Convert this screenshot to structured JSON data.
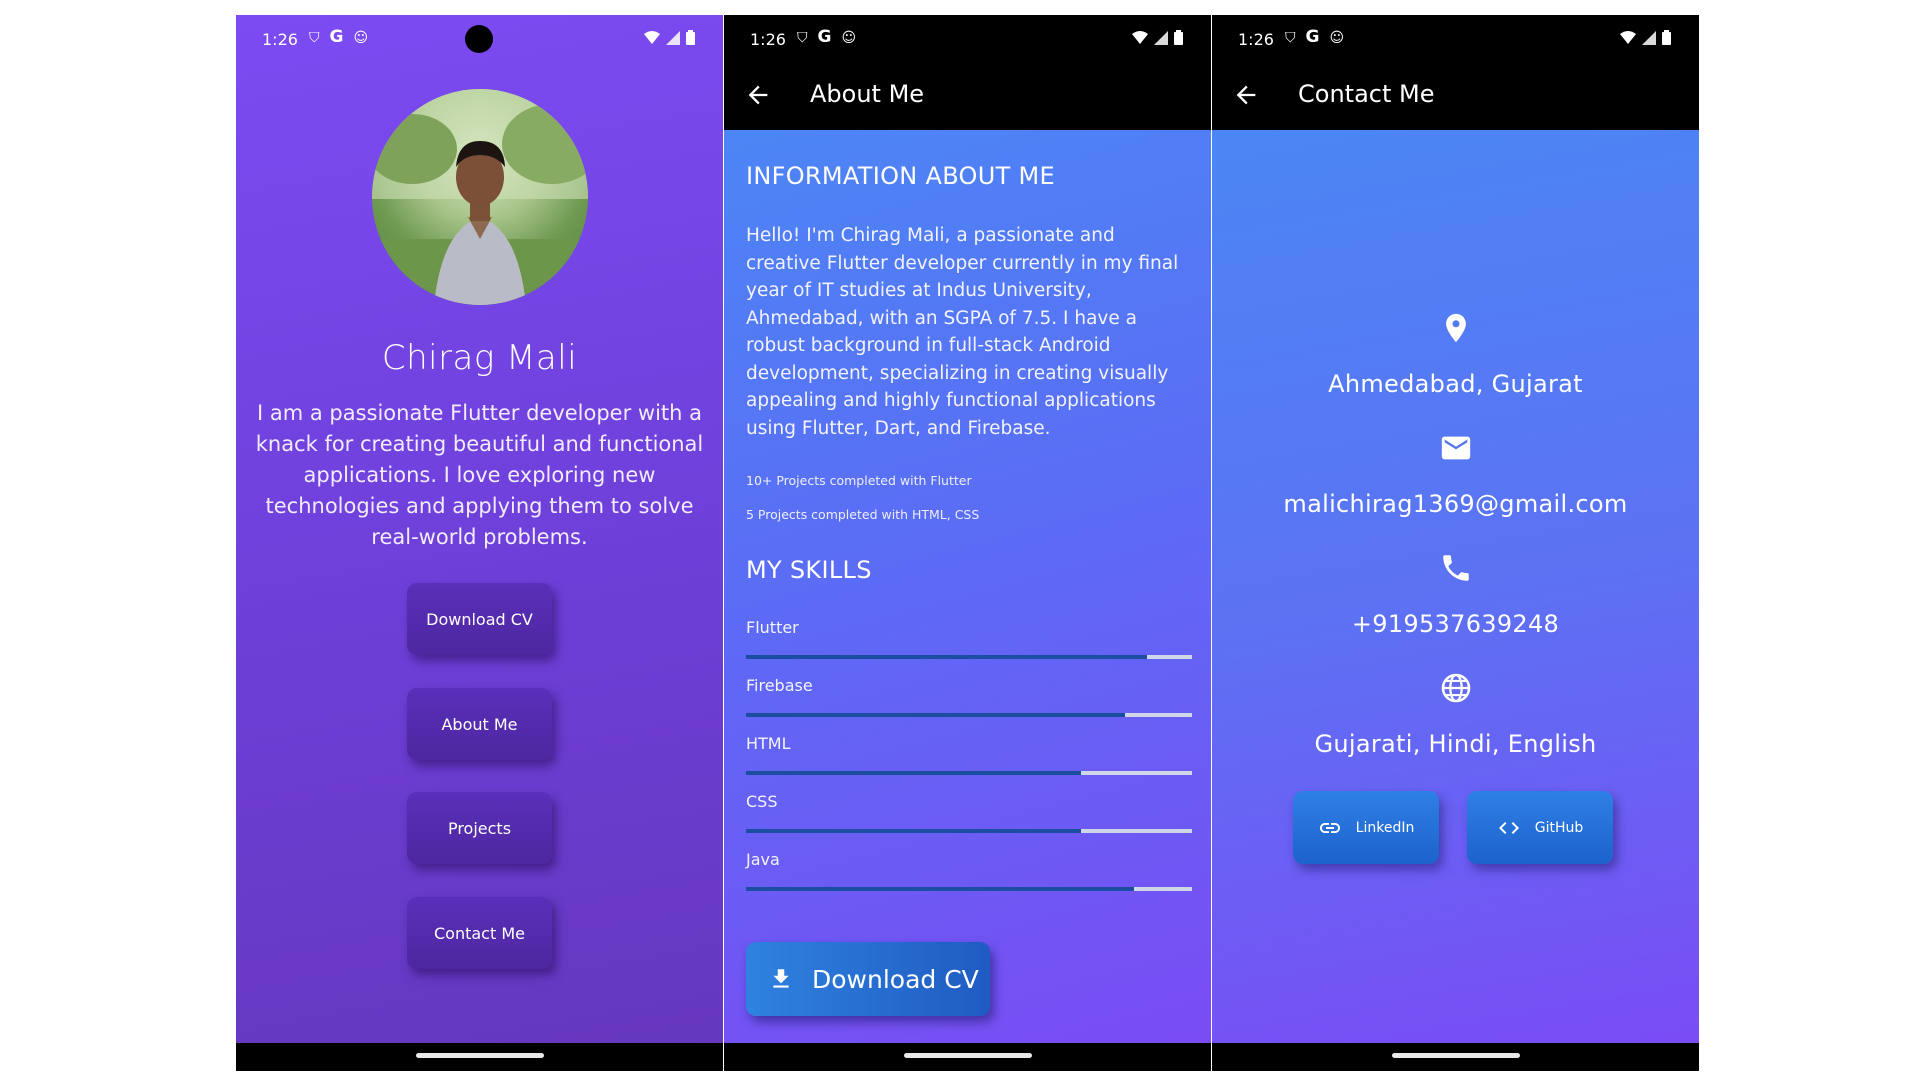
{
  "status_bar": {
    "time": "1:26"
  },
  "home": {
    "name": "Chirag Mali",
    "bio": "I am a passionate Flutter developer with a knack for creating beautiful and functional applications. I love exploring new technologies and applying them to solve real-world problems.",
    "buttons": [
      "Download CV",
      "About Me",
      "Projects",
      "Contact Me"
    ]
  },
  "about": {
    "app_title": "About Me",
    "info_heading": "INFORMATION ABOUT ME",
    "info_text": "Hello! I'm Chirag Mali, a passionate and creative Flutter developer currently in my final year of IT studies at Indus University, Ahmedabad, with an SGPA of 7.5. I have a robust background in full-stack Android development, specializing in creating visually appealing and highly functional applications using Flutter, Dart, and Firebase.",
    "notes": [
      "10+ Projects completed with Flutter",
      "5 Projects completed with HTML, CSS"
    ],
    "skills_heading": "MY SKILLS",
    "skills": [
      {
        "name": "Flutter",
        "level": 0.9
      },
      {
        "name": "Firebase",
        "level": 0.85
      },
      {
        "name": "HTML",
        "level": 0.75
      },
      {
        "name": "CSS",
        "level": 0.75
      },
      {
        "name": "Java",
        "level": 0.87
      }
    ],
    "download_label": "Download CV"
  },
  "contact": {
    "app_title": "Contact Me",
    "items": [
      {
        "icon": "location-pin-icon",
        "text": "Ahmedabad, Gujarat"
      },
      {
        "icon": "mail-icon",
        "text": "malichirag1369@gmail.com"
      },
      {
        "icon": "phone-icon",
        "text": "+919537639248"
      },
      {
        "icon": "globe-icon",
        "text": "Gujarati, Hindi, English"
      }
    ],
    "linkedin_label": "LinkedIn",
    "github_label": "GitHub"
  },
  "colors": {
    "home_gradient": "#7c4bf2",
    "menu_button": "#5a2fba",
    "skill_fill": "#1b4ea0",
    "accent_blue": "#2f82e0"
  }
}
